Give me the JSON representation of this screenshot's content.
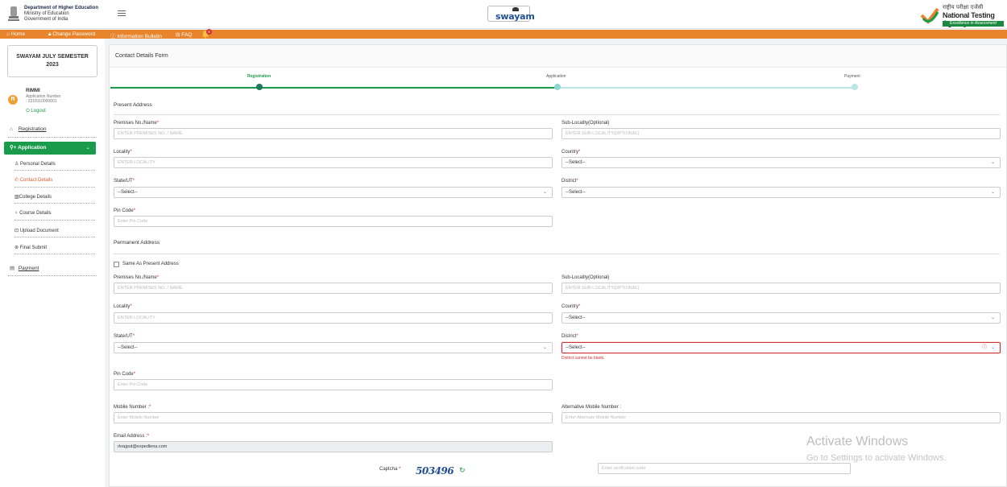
{
  "header": {
    "ministry_line1": "Department of Higher Education",
    "ministry_line2": "Ministry of Education",
    "ministry_line3": "Government of India",
    "swayam_logo": "swayam",
    "nta_hindi": "राष्ट्रीय परीक्षा एजेंसी",
    "nta_english": "National Testing Agency",
    "nta_tagline": "Excellence in Assessment"
  },
  "nav": {
    "home": "Home",
    "change_password": "Change Password",
    "information_bulletin": "Information Bulletin",
    "faq": "FAQ",
    "notification_count": "0"
  },
  "sidebar": {
    "semester_line1": "SWAYAM JULY SEMESTER",
    "semester_line2": "2023",
    "avatar_initial": "R",
    "user_name": "RIMMI",
    "app_number_label": "Application Number",
    "app_number": ": 2318110000001",
    "logout": "Logout",
    "registration": "Registration",
    "application": "Application",
    "items": [
      {
        "label": "Personal Details"
      },
      {
        "label": "Contact Details"
      },
      {
        "label": "College Details"
      },
      {
        "label": "Course Details"
      },
      {
        "label": "Upload Document"
      },
      {
        "label": "Final Submit"
      }
    ],
    "payment": "Payment"
  },
  "form": {
    "title": "Contact Details Form",
    "steps": [
      "Registration",
      "Application",
      "Payment"
    ],
    "present_address_title": "Present Address",
    "permanent_address_title": "Permanent Address",
    "same_as_present": "Same As Present Address",
    "labels": {
      "premises": "Premises No./Name",
      "sub_locality": "Sub-Locality(Optional)",
      "locality": "Locality",
      "country": "Country",
      "state": "State/UT",
      "district": "District",
      "pin": "Pin Code",
      "mobile": "Mobile Number :",
      "alt_mobile": "Alternative Mobile Number :",
      "email": "Email Address :",
      "captcha": "Captcha"
    },
    "placeholders": {
      "premises": "ENTER PREMISES NO. / NAME",
      "sub_locality": "ENTER SUB-LOCALITY(OPTIONAL)",
      "locality": "ENTER LOCALITY",
      "pin": "Enter Pin Code",
      "mobile": "Enter Mobile Number",
      "alt_mobile": "Enter Alternate Mobile Number",
      "verification": "Enter verification code"
    },
    "select_default": "--Select--",
    "district_error": "District cannot be blank.",
    "email_value": "rkrajput@expedlena.com",
    "captcha_value": "503496"
  },
  "watermark": {
    "line1": "Activate Windows",
    "line2": "Go to Settings to activate Windows."
  },
  "colors": {
    "accent_orange": "#e8842b",
    "accent_green": "#1a9a4b",
    "error_red": "#d32f2f",
    "brand_blue": "#1f4e96"
  }
}
